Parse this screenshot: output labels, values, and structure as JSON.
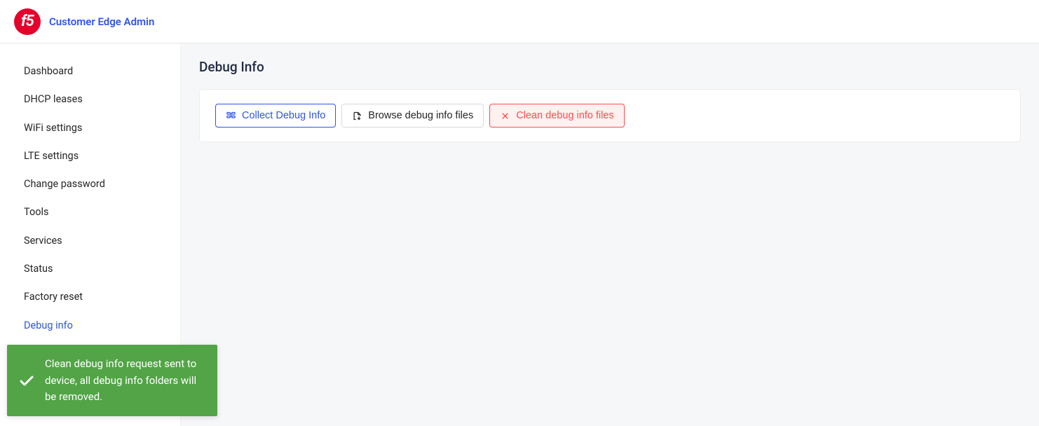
{
  "header": {
    "logo_text": "f5",
    "app_title": "Customer Edge Admin"
  },
  "sidebar": {
    "items": [
      {
        "label": "Dashboard",
        "active": false
      },
      {
        "label": "DHCP leases",
        "active": false
      },
      {
        "label": "WiFi settings",
        "active": false
      },
      {
        "label": "LTE settings",
        "active": false
      },
      {
        "label": "Change password",
        "active": false
      },
      {
        "label": "Tools",
        "active": false
      },
      {
        "label": "Services",
        "active": false
      },
      {
        "label": "Status",
        "active": false
      },
      {
        "label": "Factory reset",
        "active": false
      },
      {
        "label": "Debug info",
        "active": true
      }
    ]
  },
  "main": {
    "page_title": "Debug Info",
    "buttons": {
      "collect": "Collect Debug Info",
      "browse": "Browse debug info files",
      "clean": "Clean debug info files"
    }
  },
  "toast": {
    "message": "Clean debug info request sent to device, all debug info folders will be removed."
  }
}
